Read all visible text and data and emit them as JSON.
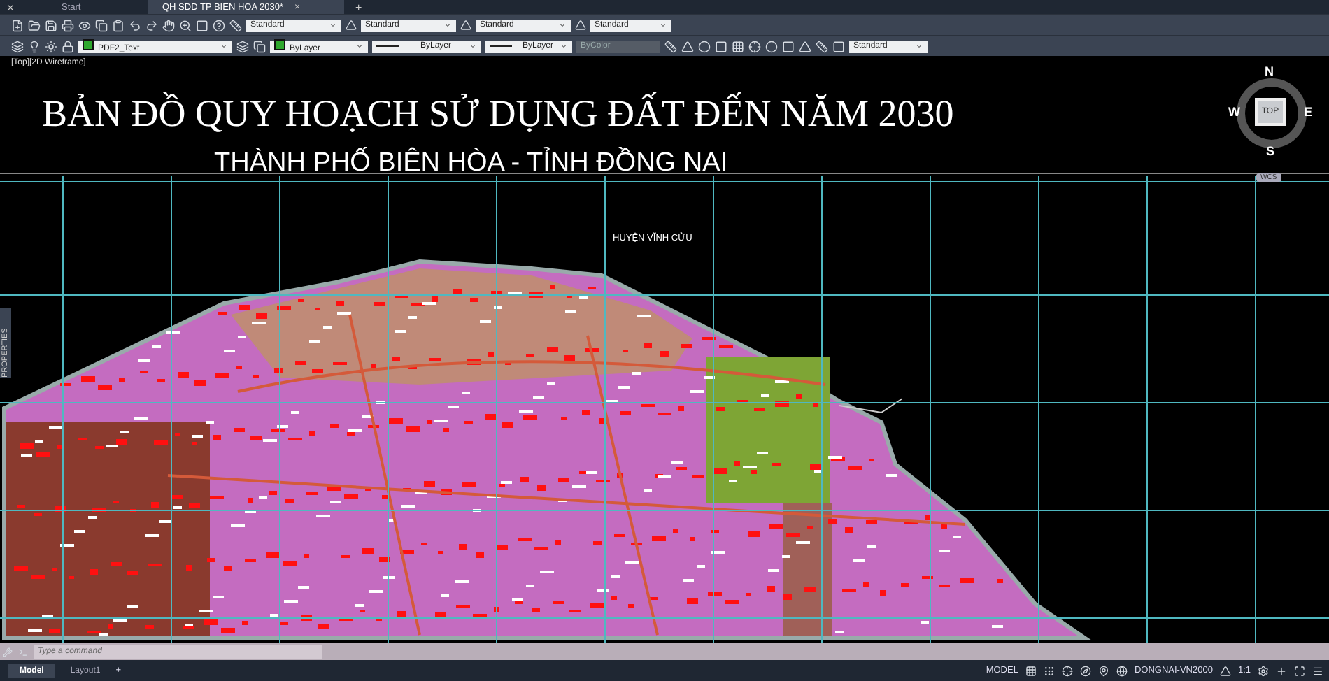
{
  "tabs": [
    {
      "label": "Start",
      "selected": false
    },
    {
      "label": "QH SDD TP BIEN HOA 2030*",
      "selected": true
    }
  ],
  "tab_close": "×",
  "tab_add": "+",
  "toolbar_1": {
    "dropdowns": [
      "Standard",
      "Standard",
      "Standard",
      "Standard"
    ]
  },
  "toolbar_2": {
    "layer": "PDF2_Text",
    "color_setting": "ByLayer",
    "linetype": "ByLayer",
    "lineweight": "ByLayer",
    "plot_style": {
      "value": "ByColor",
      "disabled": true
    },
    "style": "Standard"
  },
  "viewport": {
    "label": "[Top][2D Wireframe]",
    "title": "BẢN ĐỒ QUY HOẠCH SỬ DỤNG ĐẤT ĐẾN NĂM 2030",
    "subtitle": "THÀNH PHỐ BIÊN HÒA - TỈNH ĐỒNG NAI",
    "map_label": "HUYỆN VĨNH CỬU"
  },
  "view_cube": {
    "n": "N",
    "s": "S",
    "e": "E",
    "w": "W",
    "face": "TOP",
    "ucs": "WCS"
  },
  "side_palette": "PROPERTIES",
  "command_line": {
    "placeholder": "Type a command"
  },
  "layout_tabs": [
    {
      "label": "Model",
      "selected": true
    },
    {
      "label": "Layout1",
      "selected": false
    }
  ],
  "layout_add": "+",
  "status_bar": {
    "space": "MODEL",
    "coordinate_system": "DONGNAI-VN2000",
    "scale": "1:1"
  }
}
